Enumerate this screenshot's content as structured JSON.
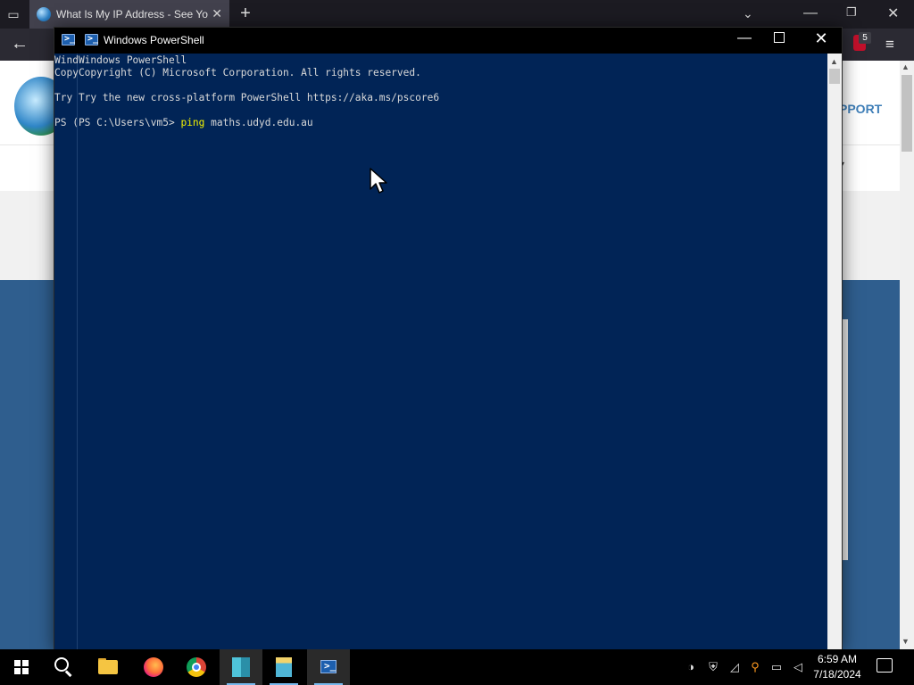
{
  "browser": {
    "tab_title": "What Is My IP Address - See Your",
    "tab_close_glyph": "✕",
    "new_tab_glyph": "+",
    "tab_list_glyph": "▭",
    "menu_glyph": "≡",
    "back_glyph": "←",
    "extension_count": "5",
    "page": {
      "support_text": "PPORT",
      "nav_dropdown_glyph": "▾"
    }
  },
  "powershell": {
    "title": "Windows PowerShell",
    "lines": [
      "WindWindows PowerShell",
      "CopyCopyright (C) Microsoft Corporation. All rights reserved.",
      "",
      "Try Try the new cross-platform PowerShell https://aka.ms/pscore6",
      ""
    ],
    "prompt": "PS (PS C:\\Users\\vm5> ",
    "command_keyword": "ping",
    "command_args": " maths.udyd.edu.au"
  },
  "taskbar": {
    "time": "6:59 AM",
    "date": "7/18/2024",
    "items": [
      "start",
      "search",
      "file-explorer",
      "firefox",
      "chrome",
      "app-building",
      "app-building-2",
      "powershell"
    ]
  },
  "colors": {
    "console_bg": "#012456",
    "console_text": "#d9d9d9",
    "command_keyword": "#f2f200",
    "taskbar_bg": "#000000",
    "hero_blue": "#2f5e8e"
  }
}
